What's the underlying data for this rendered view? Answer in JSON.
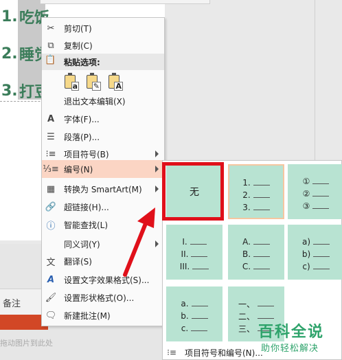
{
  "slide": {
    "lines": [
      {
        "num": "1.",
        "text": "吃饭"
      },
      {
        "num": "2.",
        "text": "睡觉"
      },
      {
        "num": "3.",
        "text": "打豆"
      }
    ],
    "notes_label": "备注",
    "drag_hint": "拖动图片到此处"
  },
  "context_menu": {
    "items": [
      {
        "id": "cut",
        "icon": "scissors-icon",
        "label": "剪切(T)"
      },
      {
        "id": "copy",
        "icon": "copy-icon",
        "label": "复制(C)"
      }
    ],
    "paste_header": "粘贴选项:",
    "paste_options": [
      {
        "id": "keep-format",
        "mark": "a"
      },
      {
        "id": "merge-format",
        "mark": "✎"
      },
      {
        "id": "text-only",
        "mark": "A"
      }
    ],
    "items2": [
      {
        "id": "exit-edit",
        "icon": "text-edit-icon",
        "label": "退出文本编辑(X)"
      },
      {
        "id": "font",
        "icon": "font-icon",
        "label": "字体(F)..."
      },
      {
        "id": "paragraph",
        "icon": "paragraph-icon",
        "label": "段落(P)..."
      },
      {
        "id": "bullets",
        "icon": "bullets-icon",
        "label": "项目符号(B)",
        "submenu": true
      },
      {
        "id": "numbering",
        "icon": "numbering-icon",
        "label": "编号(N)",
        "submenu": true,
        "active": true
      },
      {
        "id": "smartart",
        "icon": "smartart-icon",
        "label": "转换为 SmartArt(M)",
        "submenu": true
      },
      {
        "id": "hyperlink",
        "icon": "link-icon",
        "label": "超链接(H)..."
      },
      {
        "id": "smart-lookup",
        "icon": "lookup-icon",
        "label": "智能查找(L)"
      },
      {
        "id": "synonyms",
        "icon": "",
        "label": "同义词(Y)",
        "submenu": true
      },
      {
        "id": "translate",
        "icon": "translate-icon",
        "label": "翻译(S)"
      },
      {
        "id": "text-effects",
        "icon": "text-effects-icon",
        "label": "设置文字效果格式(S)..."
      },
      {
        "id": "shape-format",
        "icon": "shape-format-icon",
        "label": "设置形状格式(O)..."
      },
      {
        "id": "new-comment",
        "icon": "comment-icon",
        "label": "新建批注(M)"
      }
    ]
  },
  "numbering_gallery": {
    "none_label": "无",
    "tiles": [
      [
        "1.",
        "2.",
        "3."
      ],
      [
        "①",
        "②",
        "③"
      ],
      [
        "I.",
        "II.",
        "III."
      ],
      [
        "A.",
        "B.",
        "C."
      ],
      [
        "a)",
        "b)",
        "c)"
      ],
      [
        "a.",
        "b.",
        "c."
      ],
      [
        "一、",
        "二、",
        "三、"
      ]
    ],
    "footer_label": "项目符号和编号(N)..."
  },
  "watermark": {
    "title": "百科全说",
    "subtitle": "助你轻松解决"
  },
  "colors": {
    "accent_active": "#fbd5c4",
    "tile": "#b8e3d2",
    "highlight": "#e0101a",
    "slide_text": "#3b7d5a",
    "status_bar": "#d24726",
    "watermark": "#2ea36b"
  }
}
